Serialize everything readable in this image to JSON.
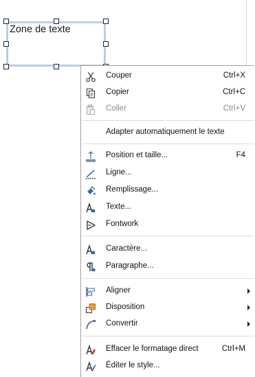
{
  "textbox": {
    "text": "Zone de texte"
  },
  "menu": {
    "items": [
      {
        "label": "Couper",
        "shortcut": "Ctrl+X",
        "icon": "cut-icon"
      },
      {
        "label": "Copier",
        "shortcut": "Ctrl+C",
        "icon": "copy-icon"
      },
      {
        "label": "Coller",
        "shortcut": "Ctrl+V",
        "icon": "paste-icon",
        "disabled": true
      },
      {
        "label": "Adapter automatiquement le texte"
      },
      {
        "label": "Position et taille...",
        "shortcut": "F4",
        "icon": "position-size-icon"
      },
      {
        "label": "Ligne...",
        "icon": "line-icon"
      },
      {
        "label": "Remplissage...",
        "icon": "fill-icon"
      },
      {
        "label": "Texte...",
        "icon": "text-attributes-icon"
      },
      {
        "label": "Fontwork",
        "icon": "fontwork-icon"
      },
      {
        "label": "Caractère...",
        "icon": "character-icon"
      },
      {
        "label": "Paragraphe...",
        "icon": "paragraph-icon"
      },
      {
        "label": "Aligner",
        "icon": "align-icon",
        "submenu": true
      },
      {
        "label": "Disposition",
        "icon": "arrange-icon",
        "submenu": true
      },
      {
        "label": "Convertir",
        "icon": "convert-icon",
        "submenu": true
      },
      {
        "label": "Effacer le formatage direct",
        "shortcut": "Ctrl+M",
        "icon": "clear-formatting-icon"
      },
      {
        "label": "Éditer le style...",
        "icon": "edit-style-icon"
      }
    ]
  },
  "colors": {
    "selection_border": "#b7cfe8",
    "icon_blue": "#2a6fb8",
    "icon_dark": "#333333"
  }
}
